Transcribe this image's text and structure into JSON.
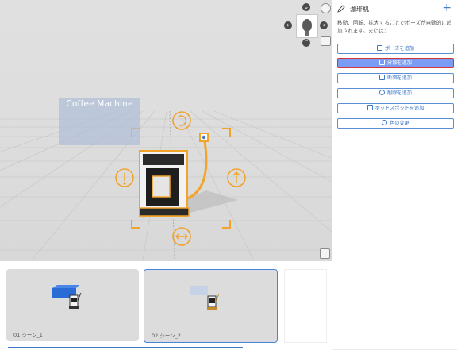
{
  "viewport": {
    "sign_label": "Coffee Machine",
    "accent_orange": "#f2a32a",
    "icons": [
      "rotate-icon",
      "move-vertical-icon",
      "move-depth-icon",
      "move-horizontal-icon"
    ]
  },
  "panel": {
    "title": "珈琲机",
    "add_label": "+",
    "description": "移動、回転、拡大することでポーズが自動的に追加されます。または：",
    "buttons": [
      {
        "label": "ポーズを追加",
        "icon": "pose-icon",
        "active": false
      },
      {
        "label": "分散を追加",
        "icon": "explode-icon",
        "active": true
      },
      {
        "label": "断面を追加",
        "icon": "section-icon",
        "active": false
      },
      {
        "label": "削除を追加",
        "icon": "delete-icon",
        "active": false
      },
      {
        "label": "ホットスポットを追加",
        "icon": "hotspot-icon",
        "active": false
      },
      {
        "label": "色の変更",
        "icon": "palette-icon",
        "active": false
      }
    ]
  },
  "scenes": [
    {
      "label": "01  シーン_1",
      "selected": false
    },
    {
      "label": "02  シーン_2",
      "selected": true
    }
  ]
}
